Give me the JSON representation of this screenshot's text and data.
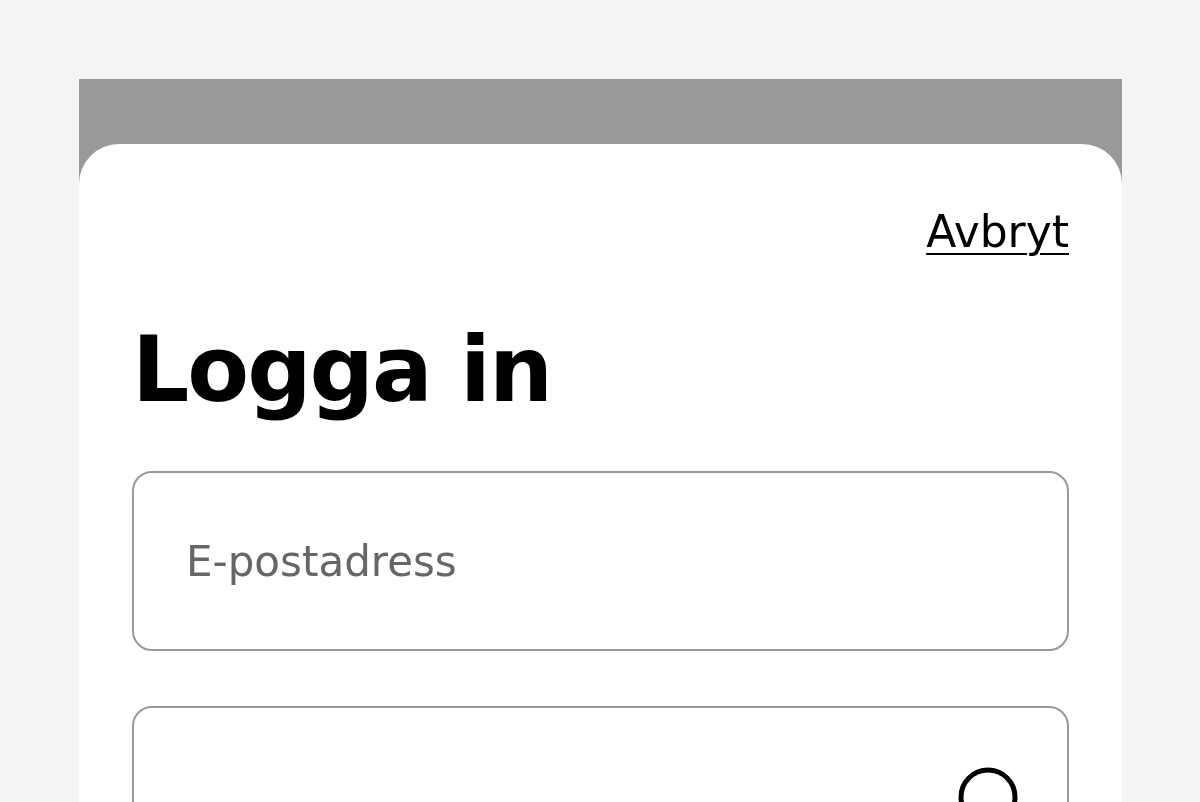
{
  "dialog": {
    "cancel_link": "Avbryt",
    "title": "Logga in"
  },
  "fields": [
    {
      "kind": "text",
      "placeholder": "E-postadress"
    },
    {
      "kind": "password"
    }
  ]
}
